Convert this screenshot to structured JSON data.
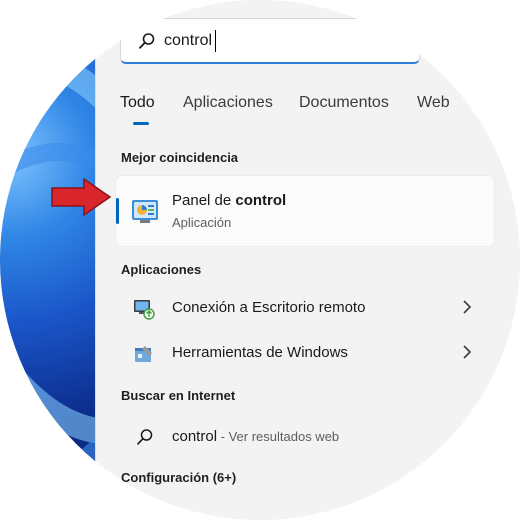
{
  "search": {
    "value": "control"
  },
  "tabs": [
    {
      "label": "Todo",
      "active": true
    },
    {
      "label": "Aplicaciones"
    },
    {
      "label": "Documentos"
    },
    {
      "label": "Web"
    }
  ],
  "best_match": {
    "heading": "Mejor coincidencia",
    "title_prefix": "Panel de ",
    "title_bold": "control",
    "subtitle": "Aplicación",
    "icon": "control-panel-icon"
  },
  "apps": {
    "heading": "Aplicaciones",
    "items": [
      {
        "label": "Conexión a Escritorio remoto",
        "icon": "remote-desktop-icon"
      },
      {
        "label": "Herramientas de Windows",
        "icon": "windows-tools-icon"
      }
    ]
  },
  "internet": {
    "heading": "Buscar en Internet",
    "query": "control",
    "suffix": " - Ver resultados web"
  },
  "settings": {
    "heading": "Configuración (6+)"
  },
  "colors": {
    "accent": "#0067c0",
    "arrow": "#d9252c"
  }
}
